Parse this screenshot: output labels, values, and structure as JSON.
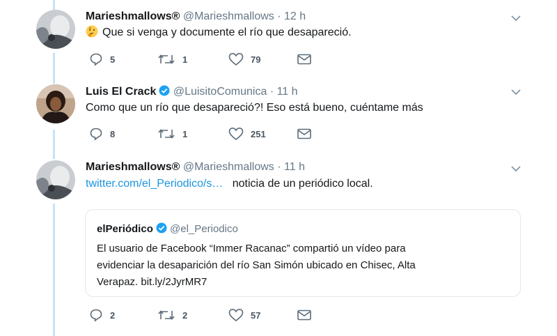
{
  "tweets": [
    {
      "name": "Marieshmallows®",
      "handle": "@Marieshmallows",
      "separator": "·",
      "time": "12 h",
      "text": "Que si venga y  documente el río que desapareció.",
      "emoji_icon": "thinking-face-emoji",
      "replies": "5",
      "retweets": "1",
      "likes": "79"
    },
    {
      "name": "Luis El Crack",
      "handle": "@LuisitoComunica",
      "separator": "·",
      "time": "11 h",
      "verified": true,
      "text": "Como que un río que desapareció?! Eso está bueno, cuéntame más",
      "replies": "8",
      "retweets": "1",
      "likes": "251"
    },
    {
      "name": "Marieshmallows®",
      "handle": "@Marieshmallows",
      "separator": "·",
      "time": "11 h",
      "link_text": "twitter.com/el_Periodico/s…",
      "text": "noticia de un periódico local.",
      "quoted": {
        "name": "elPeriódico",
        "handle": "@el_Periodico",
        "verified": true,
        "lines": [
          "El usuario de Facebook “Immer Racanac” compartió un vídeo para",
          "evidenciar la desaparición del río San Simón ubicado en Chisec, Alta",
          "Verapaz. bit.ly/2JyrMR7"
        ]
      },
      "replies": "2",
      "retweets": "2",
      "likes": "57"
    }
  ],
  "colors": {
    "accent": "#1da1f2",
    "link": "#1b95e0",
    "secondary_text": "#657786",
    "thread_line": "#c4e2f7"
  }
}
